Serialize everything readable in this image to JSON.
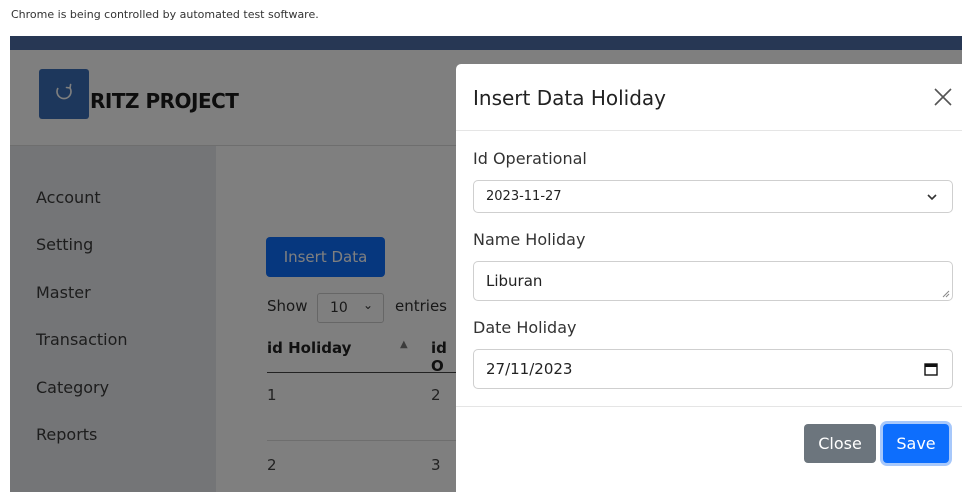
{
  "browser": {
    "infobar_text": "Chrome is being controlled by automated test software."
  },
  "brand": {
    "name": "RITZ PROJECT"
  },
  "sidebar": {
    "items": [
      {
        "label": "Account"
      },
      {
        "label": "Setting"
      },
      {
        "label": "Master"
      },
      {
        "label": "Transaction"
      },
      {
        "label": "Category"
      },
      {
        "label": "Reports"
      }
    ]
  },
  "page": {
    "insert_button": "Insert Data",
    "show_label": "Show",
    "page_size": "10",
    "entries_label": "entries",
    "columns": [
      "id Holiday",
      "id O"
    ],
    "rows": [
      {
        "id_holiday": "1",
        "id_operational": "2"
      },
      {
        "id_holiday": "2",
        "id_operational": "3"
      }
    ]
  },
  "modal": {
    "title": "Insert Data Holiday",
    "fields": {
      "id_operational": {
        "label": "Id Operational",
        "value": "2023-11-27"
      },
      "name_holiday": {
        "label": "Name Holiday",
        "value": "Liburan"
      },
      "date_holiday": {
        "label": "Date Holiday",
        "value": "27/11/2023"
      }
    },
    "close_button": "Close",
    "save_button": "Save"
  },
  "colors": {
    "primary": "#0d6efd",
    "secondary": "#6c757d",
    "header_strip": "#4e6fa8",
    "logo": "#3a6fb8"
  }
}
